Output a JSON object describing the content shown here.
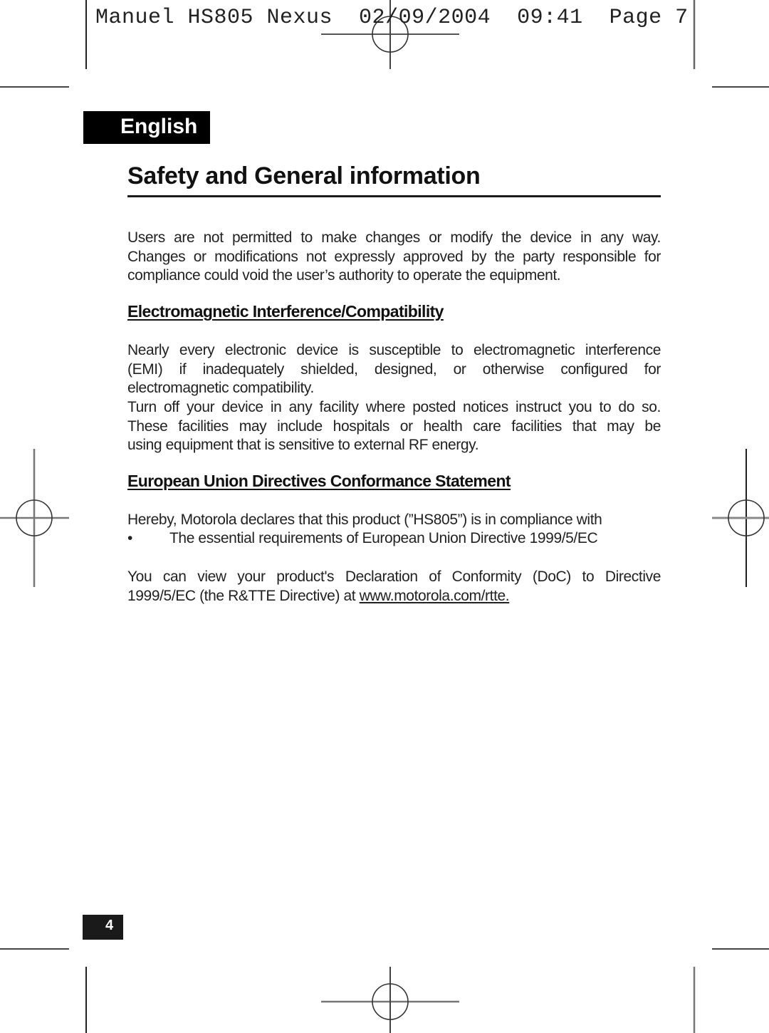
{
  "slug": {
    "text": "Manuel HS805 Nexus  02/09/2004  09:41  Page 7"
  },
  "language_tab": "English",
  "title": "Safety and General information",
  "intro": {
    "lines": [
      "Users are not permitted to make changes or modify the device in any way.",
      "Changes or modifications not expressly approved by the party responsible for",
      "compliance could void the user’s authority to operate the equipment."
    ]
  },
  "sections": [
    {
      "heading": "Electromagnetic Interference/Compatibility",
      "paragraphs": [
        {
          "lines": [
            "Nearly every electronic device is susceptible to electromagnetic interference",
            "(EMI) if inadequately shielded, designed, or otherwise configured for",
            "electromagnetic compatibility."
          ]
        },
        {
          "lines": [
            "Turn off your device in any facility where posted notices instruct you to do so.",
            "These facilities may include hospitals or health care facilities that may be",
            "using equipment that is sensitive to external RF energy."
          ]
        }
      ]
    },
    {
      "heading": "European Union Directives Conformance Statement",
      "intro": "Hereby, Motorola declares that this product (”HS805”) is in compliance with",
      "bullets": [
        {
          "symbol": "•",
          "text": "The essential requirements of European Union Directive 1999/5/EC"
        }
      ],
      "doc_text": {
        "line1": "You can view your product's Declaration of Conformity (DoC) to Directive",
        "line2_prefix": "1999/5/EC (the R&TTE Directive) at ",
        "link": "www.motorola.com/rtte."
      }
    }
  ],
  "page_number": "4",
  "icons": {
    "registration_marks": "registration-target-icon",
    "crop_marks": "crop-mark-line"
  }
}
